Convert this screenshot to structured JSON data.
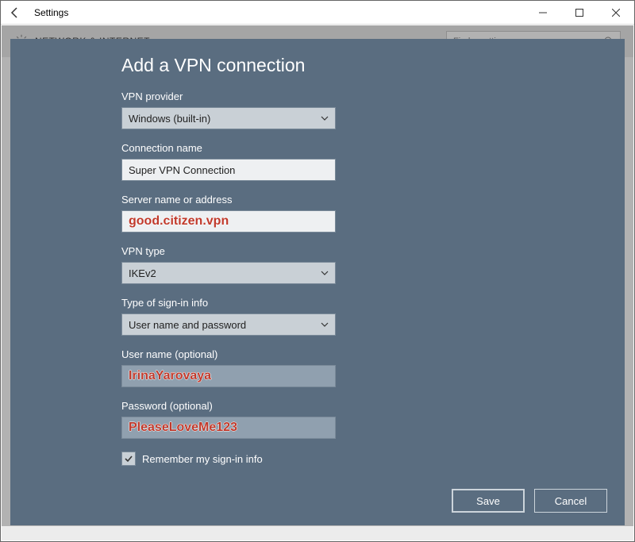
{
  "window": {
    "title": "Settings"
  },
  "background": {
    "heading": "NETWORK & INTERNET",
    "search_placeholder": "Find a setting"
  },
  "dialog": {
    "title": "Add a VPN connection",
    "fields": {
      "vpn_provider": {
        "label": "VPN provider",
        "value": "Windows (built-in)"
      },
      "connection_name": {
        "label": "Connection name",
        "value": "Super VPN Connection"
      },
      "server_name": {
        "label": "Server name or address",
        "value": "good.citizen.vpn"
      },
      "vpn_type": {
        "label": "VPN type",
        "value": "IKEv2"
      },
      "signin_type": {
        "label": "Type of sign-in info",
        "value": "User name and password"
      },
      "username": {
        "label": "User name (optional)",
        "value": "IrinaYarovaya"
      },
      "password": {
        "label": "Password (optional)",
        "value": "PleaseLoveMe123"
      }
    },
    "remember": {
      "label": "Remember my sign-in info",
      "checked": true
    },
    "buttons": {
      "save": "Save",
      "cancel": "Cancel"
    }
  }
}
